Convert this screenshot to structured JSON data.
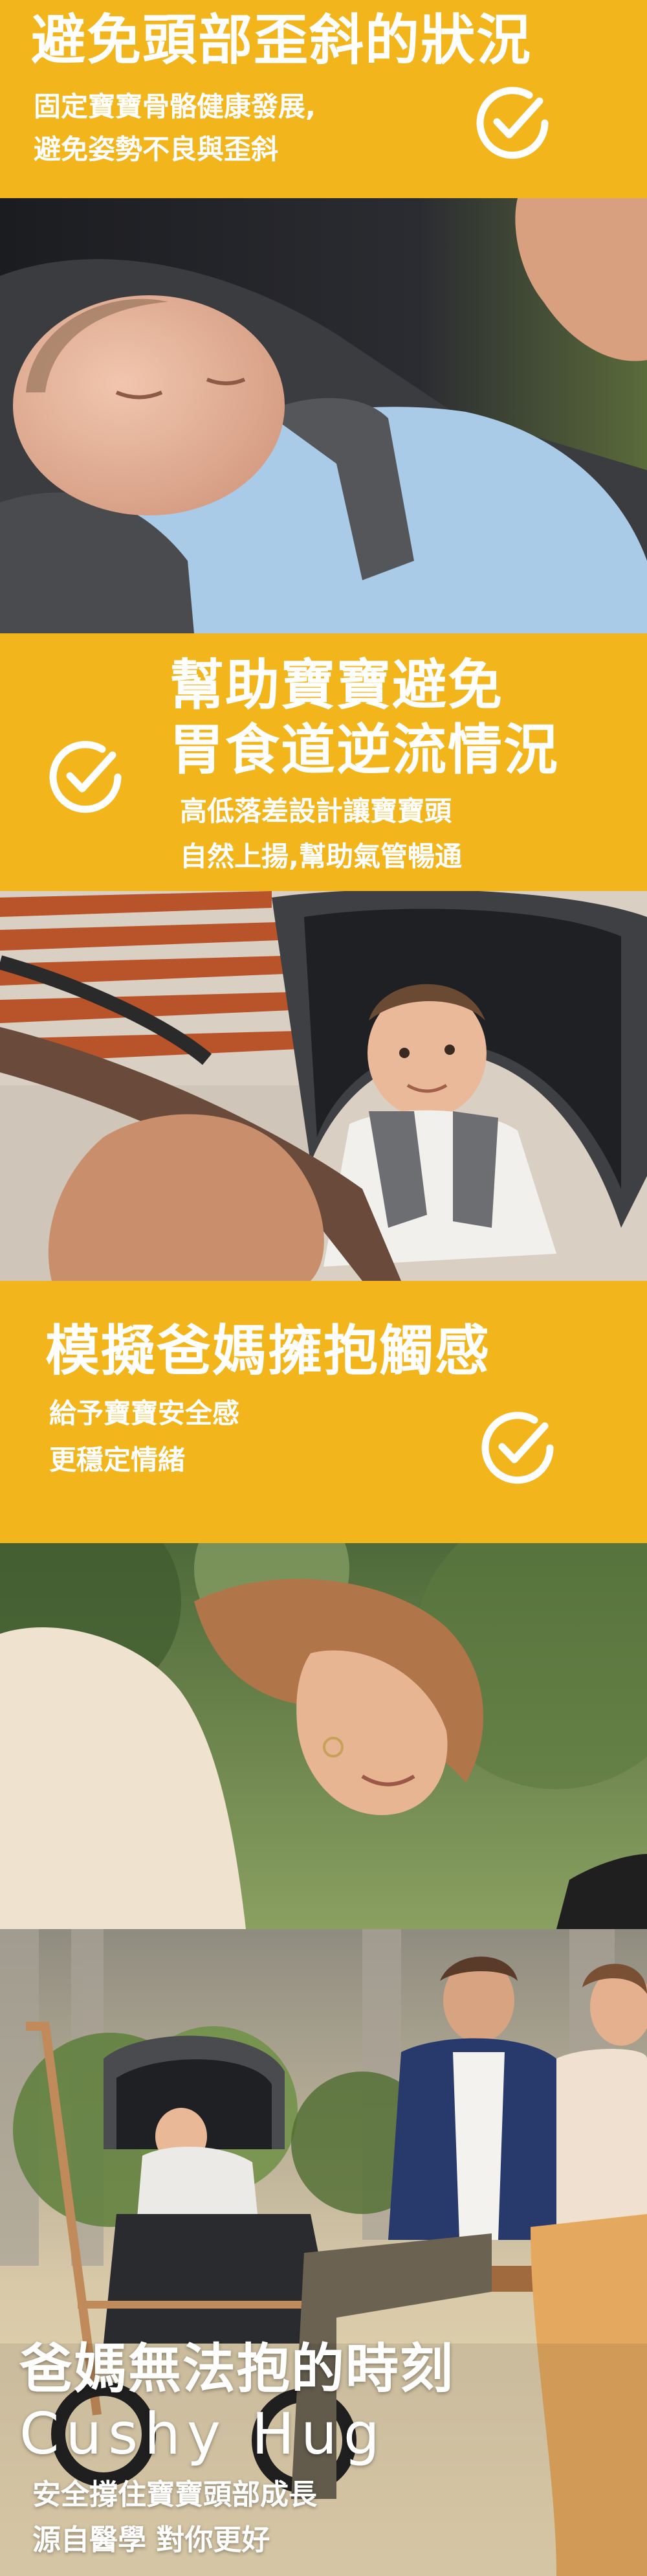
{
  "section1": {
    "title": "避免頭部歪斜的狀況",
    "desc_line1": "固定寶寶骨骼健康發展,",
    "desc_line2": "避免姿勢不良與歪斜"
  },
  "section2": {
    "title_line1": "幫助寶寶避免",
    "title_line2": "胃食道逆流情況",
    "desc_line1": "高低落差設計讓寶寶頭",
    "desc_line2": "自然上揚,幫助氣管暢通"
  },
  "section3": {
    "title": "模擬爸媽擁抱觸感",
    "desc_line1": "給予寶寶安全感",
    "desc_line2": "更穩定情緒"
  },
  "section4": {
    "title": "爸媽無法抱的時刻",
    "product": "Cushy Hug",
    "desc_line1": "安全撐住寶寶頭部成長",
    "desc_line2": "源自醫學 對你更好"
  },
  "colors": {
    "accent_yellow": "#f2b51c",
    "text_white": "#ffffff"
  },
  "icons": [
    "checkmark-circle-icon"
  ]
}
